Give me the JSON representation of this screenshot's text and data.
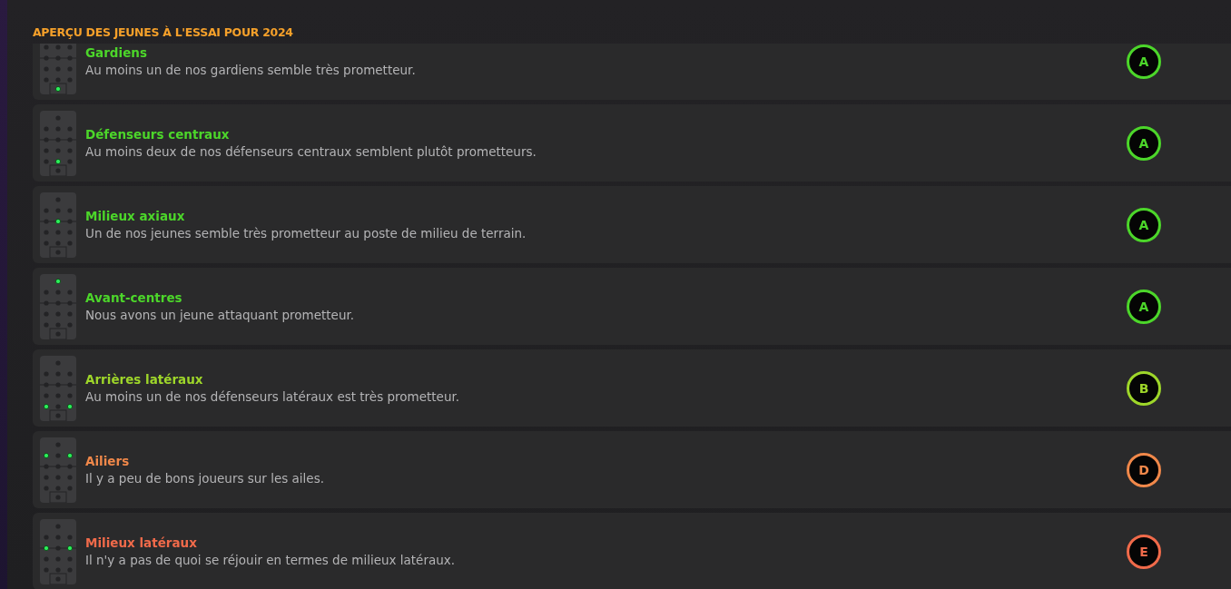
{
  "title": "APERÇU DES JEUNES À L'ESSAI POUR 2024",
  "items": [
    {
      "position": "Gardiens",
      "comment": "Au moins un de nos gardiens semble très prometteur.",
      "grade": "A",
      "color": "#4cd62a",
      "pitch_rows": [
        [
          false,
          false,
          false
        ],
        [
          false,
          false,
          false
        ],
        [
          false,
          false,
          false
        ],
        [
          false,
          false,
          false
        ],
        [
          true
        ]
      ]
    },
    {
      "position": "Défenseurs centraux",
      "comment": "Au moins deux de nos défenseurs centraux semblent plutôt prometteurs.",
      "grade": "A",
      "color": "#4cd62a",
      "pitch_rows": [
        [
          false
        ],
        [
          false,
          false,
          false
        ],
        [
          false,
          false,
          false
        ],
        [
          false,
          false,
          false
        ],
        [
          false,
          true,
          false
        ],
        [
          false
        ]
      ]
    },
    {
      "position": "Milieux axiaux",
      "comment": "Un de nos jeunes semble très prometteur au poste de milieu de terrain.",
      "grade": "A",
      "color": "#4cd62a",
      "pitch_rows": [
        [
          false
        ],
        [
          false,
          false,
          false
        ],
        [
          false,
          true,
          false
        ],
        [
          false,
          false,
          false
        ],
        [
          false,
          false,
          false
        ],
        [
          false
        ]
      ]
    },
    {
      "position": "Avant-centres",
      "comment": "Nous avons un jeune attaquant prometteur.",
      "grade": "A",
      "color": "#4cd62a",
      "pitch_rows": [
        [
          true
        ],
        [
          false,
          false,
          false
        ],
        [
          false,
          false,
          false
        ],
        [
          false,
          false,
          false
        ],
        [
          false,
          false,
          false
        ],
        [
          false
        ]
      ]
    },
    {
      "position": "Arrières latéraux",
      "comment": "Au moins un de nos défenseurs latéraux est très prometteur.",
      "grade": "B",
      "color": "#9ed62a",
      "pitch_rows": [
        [
          false
        ],
        [
          false,
          false,
          false
        ],
        [
          false,
          false,
          false
        ],
        [
          false,
          false,
          false
        ],
        [
          true,
          false,
          true
        ],
        [
          false
        ]
      ]
    },
    {
      "position": "Ailiers",
      "comment": "Il y a peu de bons joueurs sur les ailes.",
      "grade": "D",
      "color": "#f0884a",
      "pitch_rows": [
        [
          false
        ],
        [
          true,
          false,
          true
        ],
        [
          false,
          false,
          false
        ],
        [
          false,
          false,
          false
        ],
        [
          false,
          false,
          false
        ],
        [
          false
        ]
      ]
    },
    {
      "position": "Milieux latéraux",
      "comment": "Il n'y a pas de quoi se réjouir en termes de milieux latéraux.",
      "grade": "E",
      "color": "#f06a4a",
      "pitch_rows": [
        [
          false
        ],
        [
          false,
          false,
          false
        ],
        [
          true,
          false,
          true
        ],
        [
          false,
          false,
          false
        ],
        [
          false,
          false,
          false
        ],
        [
          false
        ]
      ]
    }
  ]
}
